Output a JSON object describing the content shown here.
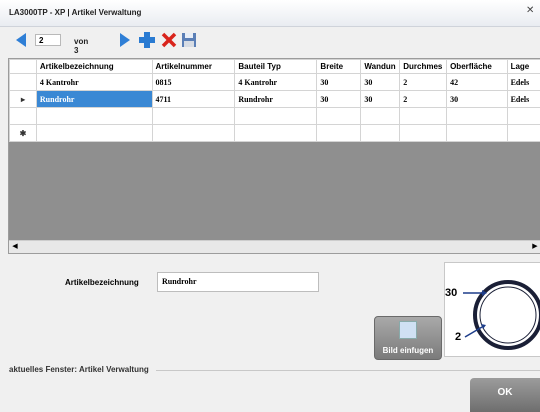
{
  "window": {
    "title": "LA3000TP - XP | Artikel Verwaltung"
  },
  "navigator": {
    "current_record": "2",
    "of_label": "von 3"
  },
  "grid": {
    "columns": [
      "Artikelbezeichnung",
      "Artikelnummer",
      "Bauteil Typ",
      "Breite",
      "Wandun",
      "Durchmes",
      "Oberfläche",
      "Lage"
    ],
    "rows": [
      {
        "marker": "",
        "cells": [
          "4 Kantrohr",
          "0815",
          "4 Kantrohr",
          "30",
          "30",
          "2",
          "42",
          "Edels"
        ]
      },
      {
        "marker": "▸",
        "cells": [
          "Rundrohr",
          "4711",
          "Rundrohr",
          "30",
          "30",
          "2",
          "30",
          "Edels"
        ]
      },
      {
        "marker": "",
        "cells": [
          "",
          "",
          "",
          "",
          "",
          "",
          "",
          ""
        ]
      },
      {
        "marker": "✱",
        "cells": [
          "",
          "",
          "",
          "",
          "",
          "",
          "",
          ""
        ]
      }
    ]
  },
  "form": {
    "name_label": "Artikelbezeichnung",
    "name_value": "Rundrohr"
  },
  "image_panel": {
    "dim_outer": "30",
    "dim_wall": "2"
  },
  "buttons": {
    "insert_image": "Bild einfugen",
    "ok": "OK"
  },
  "status": {
    "text": "aktuelles Fenster: Artikel Verwaltung"
  }
}
